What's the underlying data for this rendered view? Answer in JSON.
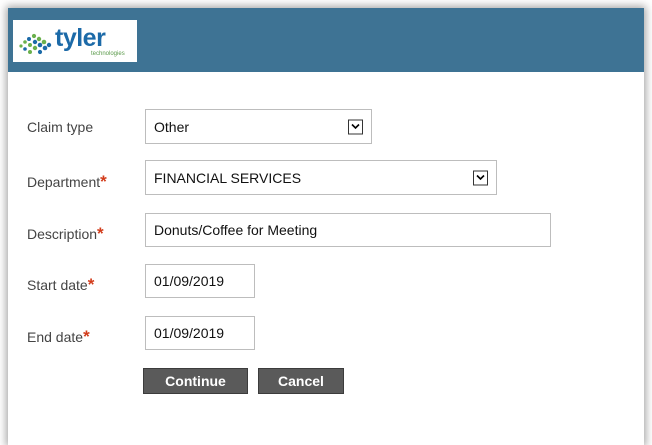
{
  "header": {
    "logo_text": "tyler",
    "logo_subtext": "technologies",
    "colors": {
      "header_bg": "#3e7394",
      "logo_blue": "#1c6aa8",
      "logo_green": "#6ab04c",
      "required": "#d23b1a",
      "button_bg": "#5a5a5a"
    }
  },
  "form": {
    "claim_type": {
      "label": "Claim type",
      "value": "Other"
    },
    "department": {
      "label": "Department",
      "required_mark": "*",
      "value": "FINANCIAL SERVICES"
    },
    "description": {
      "label": "Description",
      "required_mark": "*",
      "value": "Donuts/Coffee for Meeting"
    },
    "start_date": {
      "label": "Start date",
      "required_mark": "*",
      "value": "01/09/2019"
    },
    "end_date": {
      "label": "End date",
      "required_mark": "*",
      "value": "01/09/2019"
    }
  },
  "buttons": {
    "continue_label": "Continue",
    "cancel_label": "Cancel"
  },
  "icons": {
    "dropdown": "chevron-down-icon",
    "logo": "tyler-logo-dots-icon"
  }
}
